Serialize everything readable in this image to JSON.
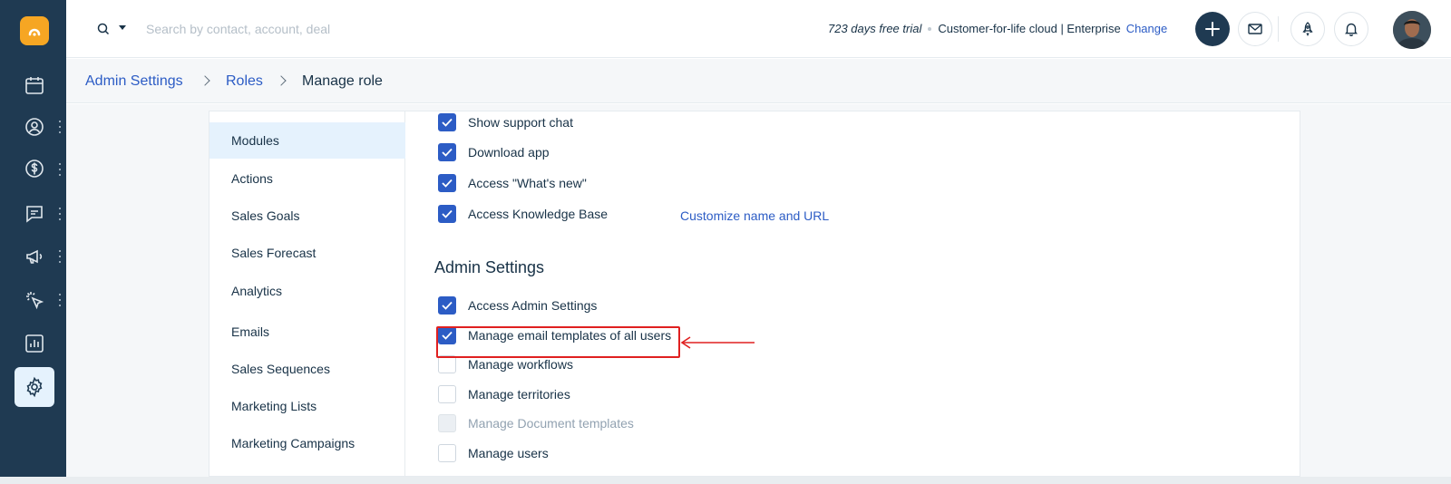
{
  "search": {
    "placeholder": "Search by contact, account, deal"
  },
  "topbar": {
    "trial_text": "723 days free trial",
    "plan_text": "Customer-for-life cloud | Enterprise",
    "change_label": "Change"
  },
  "breadcrumb": {
    "admin_settings": "Admin Settings",
    "roles": "Roles",
    "current": "Manage role"
  },
  "menu": {
    "items": [
      {
        "label": "Modules"
      },
      {
        "label": "Actions"
      },
      {
        "label": "Sales Goals"
      },
      {
        "label": "Sales Forecast"
      },
      {
        "label": "Analytics"
      },
      {
        "label": "Emails"
      },
      {
        "label": "Sales Sequences"
      },
      {
        "label": "Marketing Lists"
      },
      {
        "label": "Marketing Campaigns"
      }
    ],
    "active": "Modules"
  },
  "permissions_top": [
    {
      "label": "Show support chat",
      "checked": true
    },
    {
      "label": "Download app",
      "checked": true
    },
    {
      "label": "Access \"What's new\"",
      "checked": true
    },
    {
      "label": "Access Knowledge Base",
      "checked": true
    }
  ],
  "customize_link": "Customize name and URL",
  "admin_section": {
    "title": "Admin Settings",
    "items": [
      {
        "label": "Access Admin Settings",
        "checked": true
      },
      {
        "label": "Manage email templates of all users",
        "checked": true
      },
      {
        "label": "Manage workflows",
        "checked": false
      },
      {
        "label": "Manage territories",
        "checked": false
      },
      {
        "label": "Manage Document templates",
        "checked": false,
        "disabled": true
      },
      {
        "label": "Manage users",
        "checked": false
      }
    ]
  },
  "colors": {
    "rail": "#1f3a52",
    "accent": "#2c5cc5",
    "highlight": "#e02020",
    "logo": "#f6a623"
  }
}
